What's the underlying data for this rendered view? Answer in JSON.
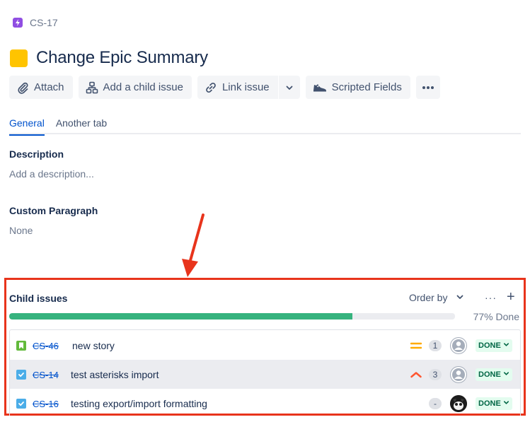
{
  "breadcrumb": {
    "issue_key": "CS-17"
  },
  "issue": {
    "title": "Change Epic Summary"
  },
  "toolbar": {
    "attach_label": "Attach",
    "add_child_label": "Add a child issue",
    "link_issue_label": "Link issue",
    "scripted_fields_label": "Scripted Fields",
    "more_label": "•••"
  },
  "tabs": [
    {
      "label": "General",
      "active": true
    },
    {
      "label": "Another tab",
      "active": false
    }
  ],
  "fields": {
    "description": {
      "label": "Description",
      "value": "Add a description..."
    },
    "custom_paragraph": {
      "label": "Custom Paragraph",
      "value": "None"
    }
  },
  "child_issues": {
    "title": "Child issues",
    "order_by_label": "Order by",
    "more_label": "···",
    "add_label": "+",
    "progress_percent": 77,
    "progress_text": "77% Done",
    "items": [
      {
        "key": "CS-46",
        "summary": "new story",
        "type": "story",
        "priority": "medium",
        "count": "1",
        "avatar": "default",
        "status": "DONE"
      },
      {
        "key": "CS-14",
        "summary": "test asterisks import",
        "type": "task",
        "priority": "high",
        "count": "3",
        "avatar": "default",
        "status": "DONE"
      },
      {
        "key": "CS-16",
        "summary": "testing export/import formatting",
        "type": "task",
        "priority": "none",
        "count": "-",
        "avatar": "photo",
        "status": "DONE"
      }
    ]
  },
  "colors": {
    "accent": "#0052cc",
    "progress_done": "#36b37e",
    "annotation": "#e8341c",
    "epic_icon": "#ffc400",
    "status_done_bg": "#e3fcef",
    "status_done_text": "#006644"
  }
}
